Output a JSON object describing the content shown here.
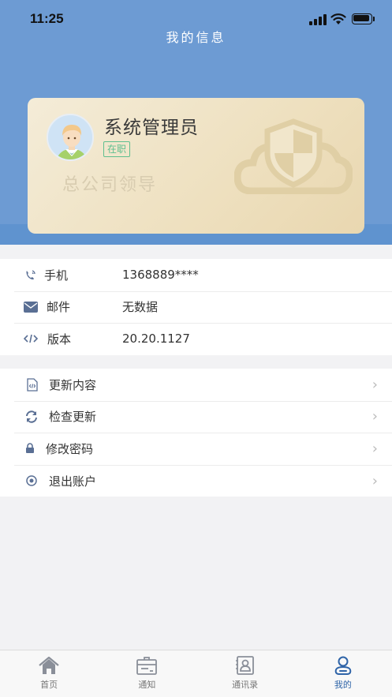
{
  "status_bar": {
    "time": "11:25"
  },
  "header": {
    "title": "我的信息"
  },
  "profile": {
    "name": "系统管理员",
    "status": "在职",
    "department": "总公司领导"
  },
  "info": [
    {
      "icon": "phone-icon",
      "label": "手机",
      "value": "1368889****"
    },
    {
      "icon": "mail-icon",
      "label": "邮件",
      "value": "无数据"
    },
    {
      "icon": "code-icon",
      "label": "版本",
      "value": "20.20.1127"
    }
  ],
  "actions": [
    {
      "icon": "file-code-icon",
      "label": "更新内容"
    },
    {
      "icon": "refresh-icon",
      "label": "检查更新"
    },
    {
      "icon": "lock-icon",
      "label": "修改密码"
    },
    {
      "icon": "eye-icon",
      "label": "退出账户"
    }
  ],
  "tabs": [
    {
      "icon": "home-icon",
      "label": "首页"
    },
    {
      "icon": "notice-icon",
      "label": "通知"
    },
    {
      "icon": "contacts-icon",
      "label": "通讯录"
    },
    {
      "icon": "profile-icon",
      "label": "我的"
    }
  ],
  "colors": {
    "header": "#6d9bd3",
    "accent": "#2f64a8",
    "icon": "#5a6f94",
    "active_status": "#5fbf8f"
  }
}
